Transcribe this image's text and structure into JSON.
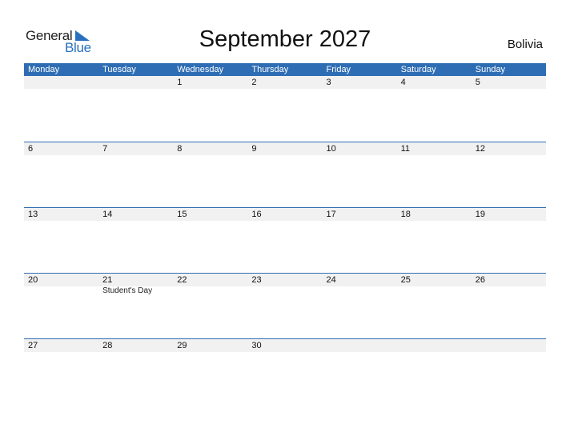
{
  "logo": {
    "line1": "General",
    "line2": "Blue"
  },
  "title": "September 2027",
  "country": "Bolivia",
  "colors": {
    "accent": "#2e6db3",
    "row_bg": "#f1f1f1",
    "logo_blue": "#2a70c0"
  },
  "weekdays": [
    "Monday",
    "Tuesday",
    "Wednesday",
    "Thursday",
    "Friday",
    "Saturday",
    "Sunday"
  ],
  "weeks": [
    {
      "dates": [
        "",
        "",
        "1",
        "2",
        "3",
        "4",
        "5"
      ],
      "events": [
        "",
        "",
        "",
        "",
        "",
        "",
        ""
      ]
    },
    {
      "dates": [
        "6",
        "7",
        "8",
        "9",
        "10",
        "11",
        "12"
      ],
      "events": [
        "",
        "",
        "",
        "",
        "",
        "",
        ""
      ]
    },
    {
      "dates": [
        "13",
        "14",
        "15",
        "16",
        "17",
        "18",
        "19"
      ],
      "events": [
        "",
        "",
        "",
        "",
        "",
        "",
        ""
      ]
    },
    {
      "dates": [
        "20",
        "21",
        "22",
        "23",
        "24",
        "25",
        "26"
      ],
      "events": [
        "",
        "Student's Day",
        "",
        "",
        "",
        "",
        ""
      ]
    },
    {
      "dates": [
        "27",
        "28",
        "29",
        "30",
        "",
        "",
        ""
      ],
      "events": [
        "",
        "",
        "",
        "",
        "",
        "",
        ""
      ]
    }
  ]
}
